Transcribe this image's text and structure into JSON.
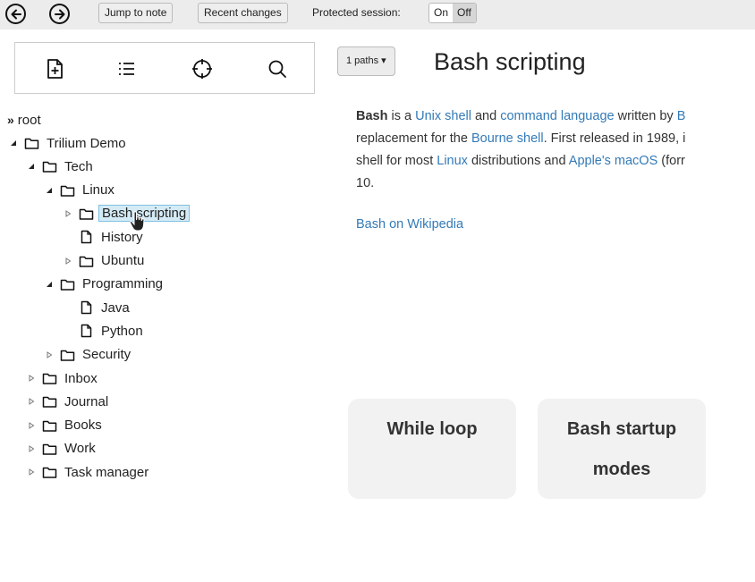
{
  "toolbar": {
    "back_icon": "arrow-left-circle",
    "forward_icon": "arrow-right-circle",
    "jump_to_note": "Jump to note",
    "recent_changes": "Recent changes",
    "protected_session_label": "Protected session:",
    "protected_on": "On",
    "protected_off": "Off"
  },
  "tree_tools": [
    "create-note-icon",
    "collapse-list-icon",
    "scroll-to-active-icon",
    "search-icon"
  ],
  "tree": {
    "root": "root",
    "items": [
      {
        "label": "Trilium Demo",
        "depth": 0,
        "expanded": true,
        "type": "folder"
      },
      {
        "label": "Tech",
        "depth": 1,
        "expanded": true,
        "type": "folder"
      },
      {
        "label": "Linux",
        "depth": 2,
        "expanded": true,
        "type": "folder"
      },
      {
        "label": "Bash scripting",
        "depth": 3,
        "expanded": false,
        "type": "folder",
        "active": true
      },
      {
        "label": "History",
        "depth": 3,
        "type": "note"
      },
      {
        "label": "Ubuntu",
        "depth": 3,
        "expanded": false,
        "type": "folder"
      },
      {
        "label": "Programming",
        "depth": 2,
        "expanded": true,
        "type": "folder"
      },
      {
        "label": "Java",
        "depth": 3,
        "type": "note"
      },
      {
        "label": "Python",
        "depth": 3,
        "type": "note"
      },
      {
        "label": "Security",
        "depth": 2,
        "expanded": false,
        "type": "folder"
      },
      {
        "label": "Inbox",
        "depth": 1,
        "expanded": false,
        "type": "folder"
      },
      {
        "label": "Journal",
        "depth": 1,
        "expanded": false,
        "type": "folder"
      },
      {
        "label": "Books",
        "depth": 1,
        "expanded": false,
        "type": "folder"
      },
      {
        "label": "Work",
        "depth": 1,
        "expanded": false,
        "type": "folder"
      },
      {
        "label": "Task manager",
        "depth": 1,
        "expanded": false,
        "type": "folder"
      }
    ]
  },
  "note": {
    "paths_button": "1 paths",
    "title": "Bash scripting",
    "line1": {
      "b": "Bash",
      "t1": " is a ",
      "a1": "Unix shell",
      "t2": " and ",
      "a2": "command language",
      "t3": " written by ",
      "a3": "B"
    },
    "line2": {
      "t1": "replacement for the ",
      "a1": "Bourne shell",
      "t2": ". First released in 1989, i"
    },
    "line3": {
      "t1": "shell for most ",
      "a1": "Linux",
      "t2": " distributions and ",
      "a2": "Apple's macOS",
      "t3": " (forr"
    },
    "line4": "10.",
    "wiki_link": "Bash on Wikipedia",
    "children": [
      "While loop",
      "Bash startup modes"
    ]
  },
  "colors": {
    "link": "#337ab7",
    "active_bg": "#d4ebf6",
    "toolbar_bg": "#ececec",
    "card_bg": "#f2f2f2"
  }
}
